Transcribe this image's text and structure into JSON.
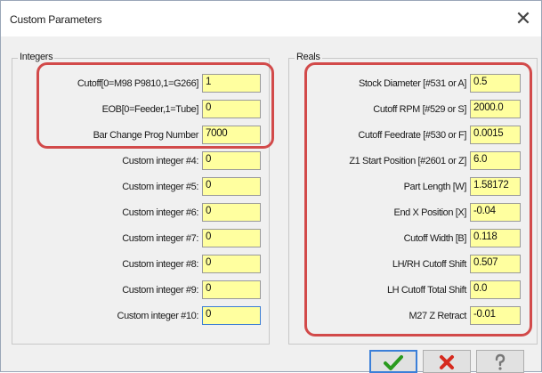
{
  "window": {
    "title": "Custom Parameters",
    "close_glyph": "✕"
  },
  "integers": {
    "group_label": "Integers",
    "rows": [
      {
        "label": "Cutoff[0=M98 P9810,1=G266]",
        "value": "1"
      },
      {
        "label": "EOB[0=Feeder,1=Tube]",
        "value": "0"
      },
      {
        "label": "Bar Change Prog Number",
        "value": "7000"
      },
      {
        "label": "Custom integer #4:",
        "value": "0"
      },
      {
        "label": "Custom integer #5:",
        "value": "0"
      },
      {
        "label": "Custom integer #6:",
        "value": "0"
      },
      {
        "label": "Custom integer #7:",
        "value": "0"
      },
      {
        "label": "Custom integer #8:",
        "value": "0"
      },
      {
        "label": "Custom integer #9:",
        "value": "0"
      },
      {
        "label": "Custom integer #10:",
        "value": "0"
      }
    ]
  },
  "reals": {
    "group_label": "Reals",
    "rows": [
      {
        "label": "Stock Diameter [#531 or A]",
        "value": "0.5"
      },
      {
        "label": "Cutoff RPM [#529 or S]",
        "value": "2000.0"
      },
      {
        "label": "Cutoff Feedrate [#530 or F]",
        "value": "0.0015"
      },
      {
        "label": "Z1 Start Position [#2601 or Z]",
        "value": "6.0"
      },
      {
        "label": "Part Length [W]",
        "value": "1.58172"
      },
      {
        "label": "End X Position [X]",
        "value": "-0.04"
      },
      {
        "label": "Cutoff Width [B]",
        "value": "0.118"
      },
      {
        "label": "LH/RH Cutoff Shift",
        "value": "0.507"
      },
      {
        "label": "LH Cutoff Total Shift",
        "value": "0.0"
      },
      {
        "label": "M27 Z Retract",
        "value": "-0.01"
      }
    ]
  },
  "buttons": {
    "ok_icon": "checkmark-icon",
    "cancel_icon": "red-x-icon",
    "help_icon": "question-mark-icon"
  },
  "colors": {
    "field_bg": "#ffff9f",
    "highlight": "#d24a4a",
    "ok_green": "#2a9a1e",
    "cancel_red": "#d62a1e",
    "focus_border": "#3d7ed4"
  }
}
